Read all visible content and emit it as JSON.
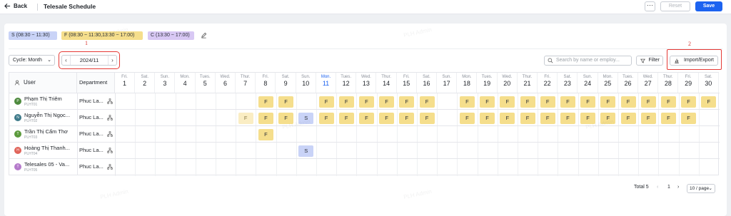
{
  "header": {
    "back_label": "Back",
    "title": "Telesale Schedule",
    "more_label": "···",
    "reset_label": "Reset",
    "save_label": "Save"
  },
  "shift_legend": [
    {
      "code": "S",
      "label": "S (08:30 ~ 11:30)",
      "color": "#c9d3f7"
    },
    {
      "code": "F",
      "label": "F (08:30 ~ 11:30,13:30 ~ 17:00)",
      "color": "#f5de8c"
    },
    {
      "code": "C",
      "label": "C (13:30 ~ 17:00)",
      "color": "#d8c8f4"
    }
  ],
  "annotations": {
    "a1": "1",
    "a2": "2"
  },
  "toolbar": {
    "cycle_label": "Cycle: Month",
    "month_value": "2024/11",
    "search_placeholder": "Search by name or employ...",
    "filter_label": "Filter",
    "import_export_label": "Import/Export"
  },
  "table": {
    "user_header": "User",
    "department_header": "Department",
    "days": [
      {
        "w": "Fri.",
        "d": "1"
      },
      {
        "w": "Sat.",
        "d": "2"
      },
      {
        "w": "Sun.",
        "d": "3"
      },
      {
        "w": "Mon.",
        "d": "4"
      },
      {
        "w": "Tues.",
        "d": "5"
      },
      {
        "w": "Wed.",
        "d": "6"
      },
      {
        "w": "Thur.",
        "d": "7"
      },
      {
        "w": "Fri.",
        "d": "8"
      },
      {
        "w": "Sat.",
        "d": "9"
      },
      {
        "w": "Sun.",
        "d": "10"
      },
      {
        "w": "Mon.",
        "d": "11"
      },
      {
        "w": "Tues.",
        "d": "12"
      },
      {
        "w": "Wed.",
        "d": "13"
      },
      {
        "w": "Thur.",
        "d": "14"
      },
      {
        "w": "Fri.",
        "d": "15"
      },
      {
        "w": "Sat.",
        "d": "16"
      },
      {
        "w": "Sun.",
        "d": "17"
      },
      {
        "w": "Mon.",
        "d": "18"
      },
      {
        "w": "Tues.",
        "d": "19"
      },
      {
        "w": "Wed.",
        "d": "20"
      },
      {
        "w": "Thur.",
        "d": "21"
      },
      {
        "w": "Fri.",
        "d": "22"
      },
      {
        "w": "Sat.",
        "d": "23"
      },
      {
        "w": "Sun.",
        "d": "24"
      },
      {
        "w": "Mon.",
        "d": "25"
      },
      {
        "w": "Tues.",
        "d": "26"
      },
      {
        "w": "Wed.",
        "d": "27"
      },
      {
        "w": "Thur.",
        "d": "28"
      },
      {
        "w": "Fri.",
        "d": "29"
      },
      {
        "w": "Sat.",
        "d": "30"
      }
    ],
    "today_day": 11,
    "rows": [
      {
        "name": "Phạm Thị Triêm",
        "code": "PLHT01",
        "initial": "P",
        "avatar_color": "#4e8a3e",
        "department": "Phuc La...",
        "shifts": [
          [
            8,
            "F"
          ],
          [
            9,
            "F"
          ],
          [
            11,
            "F"
          ],
          [
            12,
            "F"
          ],
          [
            13,
            "F"
          ],
          [
            14,
            "F"
          ],
          [
            15,
            "F"
          ],
          [
            16,
            "F"
          ],
          [
            18,
            "F"
          ],
          [
            19,
            "F"
          ],
          [
            20,
            "F"
          ],
          [
            21,
            "F"
          ],
          [
            22,
            "F"
          ],
          [
            23,
            "F"
          ],
          [
            24,
            "F"
          ],
          [
            25,
            "F"
          ],
          [
            26,
            "F"
          ],
          [
            27,
            "F"
          ],
          [
            28,
            "F"
          ],
          [
            29,
            "F"
          ],
          [
            30,
            "F"
          ]
        ]
      },
      {
        "name": "Nguyễn Thị Ngọc...",
        "code": "PLHT02",
        "initial": "N",
        "avatar_color": "#3e7a8a",
        "department": "Phuc La...",
        "shifts": [
          [
            7,
            "Fl"
          ],
          [
            8,
            "F"
          ],
          [
            9,
            "F"
          ],
          [
            10,
            "S"
          ],
          [
            11,
            "F"
          ],
          [
            12,
            "F"
          ],
          [
            13,
            "F"
          ],
          [
            14,
            "F"
          ],
          [
            15,
            "F"
          ],
          [
            16,
            "F"
          ],
          [
            18,
            "F"
          ],
          [
            19,
            "F"
          ],
          [
            20,
            "F"
          ],
          [
            21,
            "F"
          ],
          [
            22,
            "F"
          ],
          [
            23,
            "F"
          ],
          [
            24,
            "F"
          ],
          [
            25,
            "F"
          ],
          [
            26,
            "F"
          ],
          [
            27,
            "F"
          ],
          [
            28,
            "F"
          ],
          [
            29,
            "F"
          ]
        ]
      },
      {
        "name": "Trần Thị Cẩm Thơ",
        "code": "PLHT03",
        "initial": "T",
        "avatar_color": "#5b9a3c",
        "department": "Phuc La...",
        "shifts": [
          [
            8,
            "F"
          ]
        ]
      },
      {
        "name": "Hoàng Thị Thanh...",
        "code": "PLHT04",
        "initial": "H",
        "avatar_color": "#e0645a",
        "department": "Phuc La...",
        "shifts": [
          [
            10,
            "S"
          ]
        ]
      },
      {
        "name": "Telesales 05 - Va...",
        "code": "PLHT05",
        "initial": "T",
        "avatar_color": "#b57acb",
        "department": "Phuc La...",
        "shifts": []
      }
    ]
  },
  "pagination": {
    "total_label": "Total 5",
    "prev": "‹",
    "page": "1",
    "next": "›",
    "page_size": "10 / page"
  },
  "watermark": "PLH Admin"
}
